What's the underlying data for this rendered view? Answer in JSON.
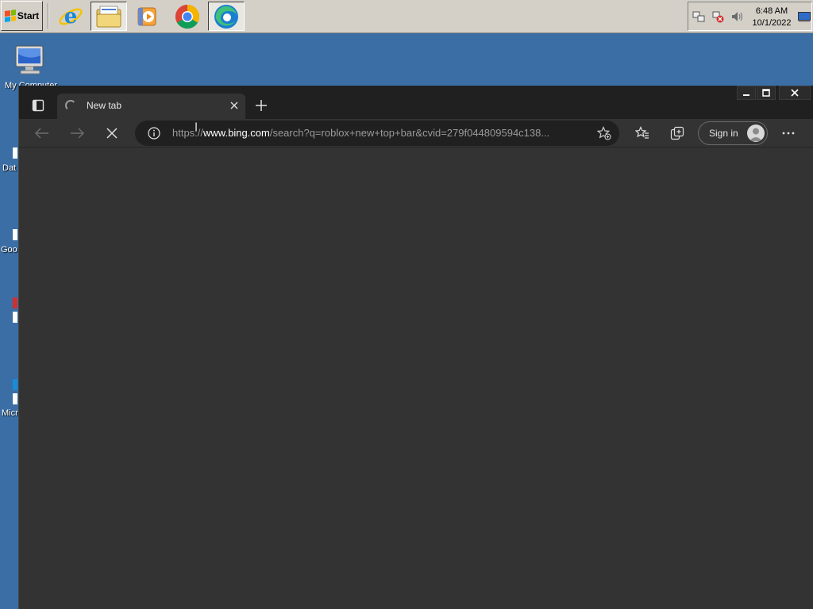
{
  "taskbar": {
    "start_label": "Start",
    "apps": [
      {
        "name": "Internet Explorer",
        "icon": "internet-explorer-icon"
      },
      {
        "name": "Windows Explorer",
        "icon": "folder-icon"
      },
      {
        "name": "Windows Media Player",
        "icon": "media-player-icon"
      },
      {
        "name": "Google Chrome",
        "icon": "chrome-icon"
      },
      {
        "name": "Microsoft Edge",
        "icon": "edge-icon",
        "active": true
      }
    ],
    "clock": {
      "time": "6:48 AM",
      "date": "10/1/2022"
    }
  },
  "desktop": {
    "icons": [
      {
        "label": "My Computer",
        "icon": "computer-icon"
      },
      {
        "label": "Dat",
        "icon": "shortcut-icon"
      },
      {
        "label": "Goo",
        "icon": "shortcut-icon"
      },
      {
        "label": "",
        "icon": "shortcut-icon"
      },
      {
        "label": "Micr",
        "icon": "shortcut-icon"
      }
    ]
  },
  "browser": {
    "tab": {
      "title": "New tab",
      "loading": true
    },
    "address": {
      "scheme": "https://",
      "host": "www.bing.com",
      "path": "/search?q=roblox+new+top+bar&cvid=279f044809594c138..."
    },
    "signin_label": "Sign in"
  },
  "colors": {
    "desktop": "#3a6ea5",
    "taskbar": "#d4d0c8",
    "browser_frame": "#202020",
    "browser_surface": "#333333"
  }
}
